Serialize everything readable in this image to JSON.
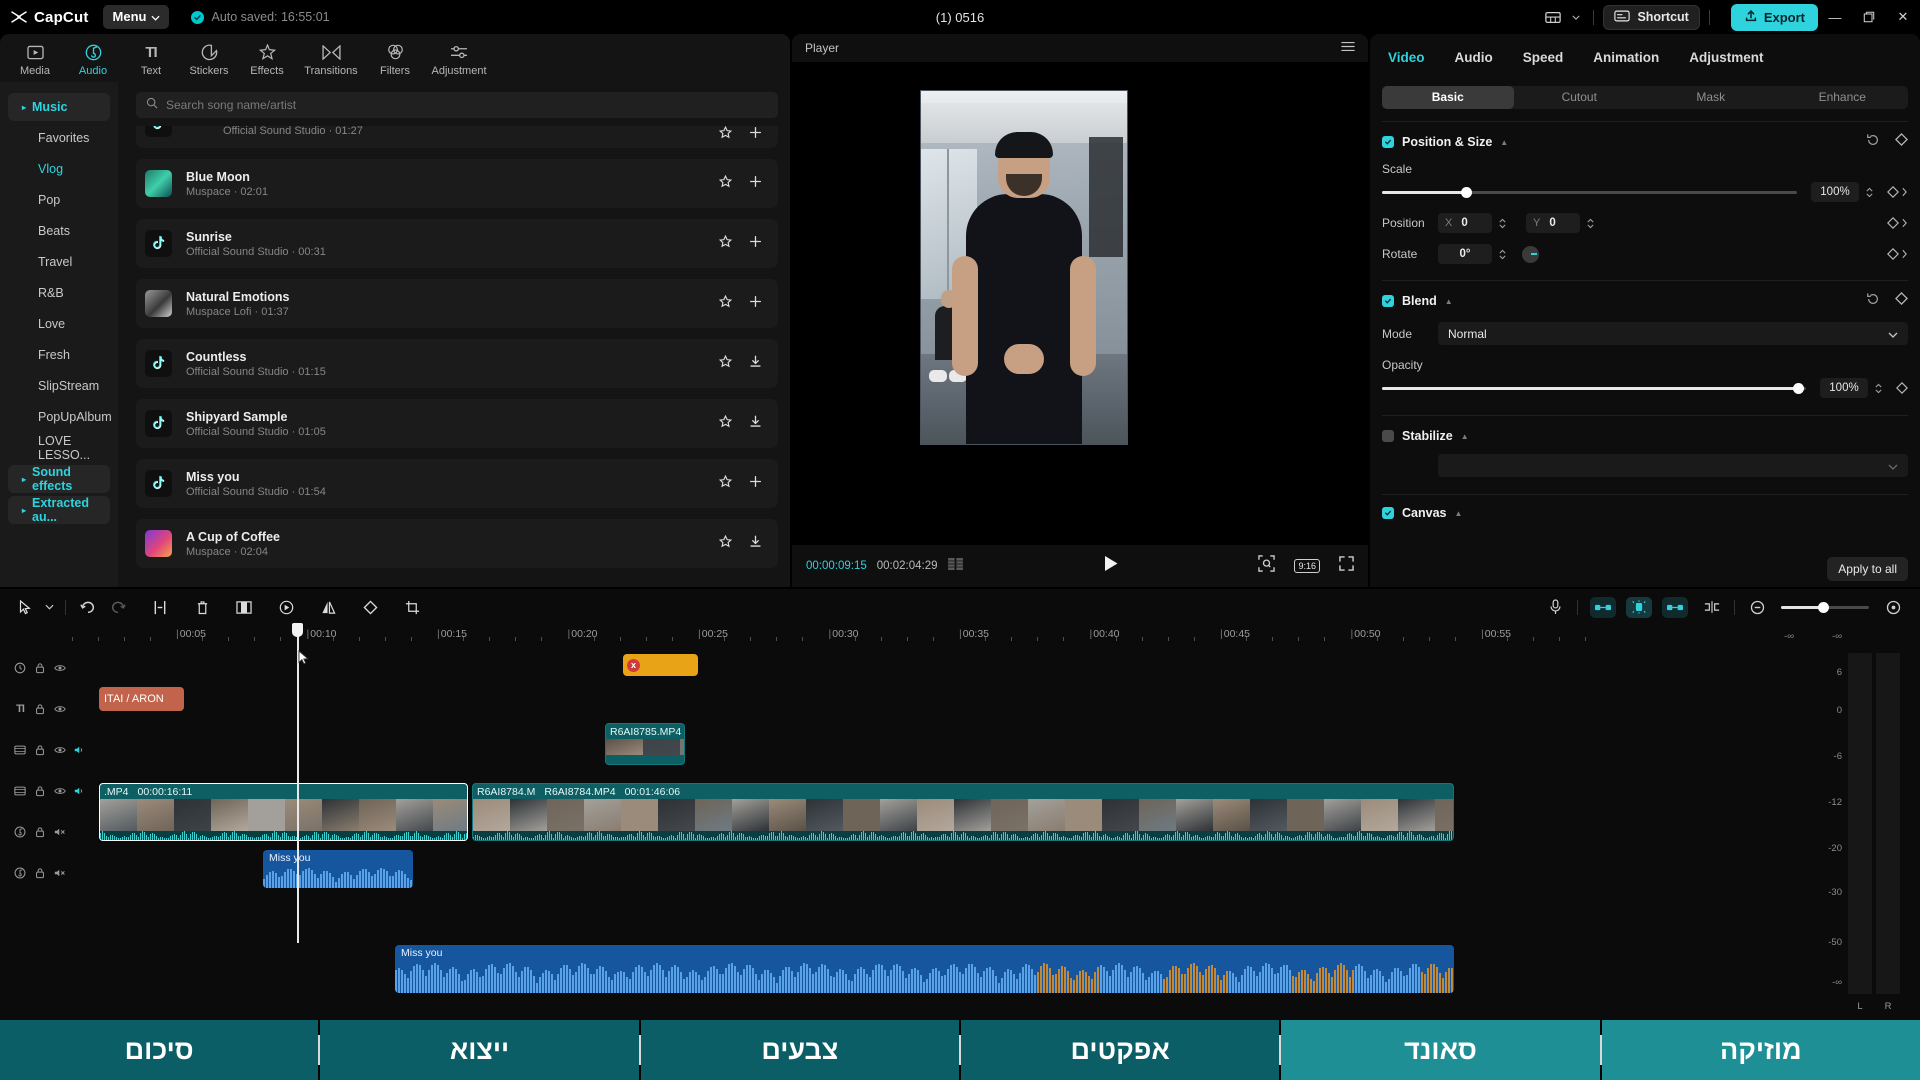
{
  "titlebar": {
    "app_name": "CapCut",
    "menu_label": "Menu",
    "autosave": "Auto saved: 16:55:01",
    "project_title": "(1) 0516",
    "shortcut_label": "Shortcut",
    "export_label": "Export",
    "minimize": "—",
    "maximize": "❐",
    "close": "✕"
  },
  "nav_tabs": [
    {
      "label": "Media",
      "icon": "media-icon",
      "active": false
    },
    {
      "label": "Audio",
      "icon": "audio-icon",
      "active": true
    },
    {
      "label": "Text",
      "icon": "text-icon",
      "active": false
    },
    {
      "label": "Stickers",
      "icon": "sticker-icon",
      "active": false
    },
    {
      "label": "Effects",
      "icon": "effects-icon",
      "active": false
    },
    {
      "label": "Transitions",
      "icon": "transitions-icon",
      "active": false
    },
    {
      "label": "Filters",
      "icon": "filters-icon",
      "active": false
    },
    {
      "label": "Adjustment",
      "icon": "adjustment-icon",
      "active": false
    }
  ],
  "categories": [
    {
      "label": "Music",
      "type": "group"
    },
    {
      "label": "Favorites",
      "type": "item"
    },
    {
      "label": "Vlog",
      "type": "selected"
    },
    {
      "label": "Pop",
      "type": "item"
    },
    {
      "label": "Beats",
      "type": "item"
    },
    {
      "label": "Travel",
      "type": "item"
    },
    {
      "label": "R&B",
      "type": "item"
    },
    {
      "label": "Love",
      "type": "item"
    },
    {
      "label": "Fresh",
      "type": "item"
    },
    {
      "label": "SlipStream",
      "type": "item"
    },
    {
      "label": "PopUpAlbum",
      "type": "item"
    },
    {
      "label": "LOVE LESSO...",
      "type": "item"
    },
    {
      "label": "Sound effects",
      "type": "group"
    },
    {
      "label": "Extracted au...",
      "type": "group"
    }
  ],
  "search": {
    "placeholder": "Search song name/artist",
    "value": ""
  },
  "songs": [
    {
      "title": "",
      "subtitle": "Official Sound Studio · 01:27",
      "cover": "tiktok",
      "action": "add",
      "clipped": true
    },
    {
      "title": "Blue Moon",
      "subtitle": "Muspace · 02:01",
      "cover": "art-teal",
      "action": "add"
    },
    {
      "title": "Sunrise",
      "subtitle": "Official Sound Studio · 00:31",
      "cover": "tiktok",
      "action": "add"
    },
    {
      "title": "Natural Emotions",
      "subtitle": "Muspace Lofi · 01:37",
      "cover": "art-gray",
      "action": "add"
    },
    {
      "title": "Countless",
      "subtitle": "Official Sound Studio · 01:15",
      "cover": "tiktok",
      "action": "download"
    },
    {
      "title": "Shipyard Sample",
      "subtitle": "Official Sound Studio · 01:05",
      "cover": "tiktok",
      "action": "download"
    },
    {
      "title": "Miss  you",
      "subtitle": "Official Sound Studio · 01:54",
      "cover": "tiktok",
      "action": "add"
    },
    {
      "title": "A Cup of Coffee",
      "subtitle": "Muspace · 02:04",
      "cover": "art-pink",
      "action": "download"
    }
  ],
  "player": {
    "label": "Player",
    "current_time": "00:00:09:15",
    "total_time": "00:02:04:29",
    "ratio": "9:16",
    "play_icon": "play-icon",
    "menu_icon": "hamburger-icon"
  },
  "props": {
    "tabs": [
      {
        "label": "Video",
        "active": true
      },
      {
        "label": "Audio",
        "active": false
      },
      {
        "label": "Speed",
        "active": false
      },
      {
        "label": "Animation",
        "active": false
      },
      {
        "label": "Adjustment",
        "active": false
      }
    ],
    "segments": [
      {
        "label": "Basic",
        "active": true
      },
      {
        "label": "Cutout",
        "active": false
      },
      {
        "label": "Mask",
        "active": false
      },
      {
        "label": "Enhance",
        "active": false
      }
    ],
    "position_size": {
      "title": "Position & Size",
      "checked": true,
      "scale_label": "Scale",
      "scale_value": "100%",
      "position_label": "Position",
      "pos_x_axis": "X",
      "pos_x_value": "0",
      "pos_y_axis": "Y",
      "pos_y_value": "0",
      "rotate_label": "Rotate",
      "rotate_value": "0°"
    },
    "blend": {
      "title": "Blend",
      "checked": true,
      "mode_label": "Mode",
      "mode_value": "Normal",
      "opacity_label": "Opacity",
      "opacity_value": "100%"
    },
    "stabilize": {
      "title": "Stabilize",
      "checked": false,
      "value": ""
    },
    "canvas": {
      "title": "Canvas",
      "checked": true
    },
    "apply_all_label": "Apply to all"
  },
  "timeline": {
    "tools": [
      "pointer-icon",
      "chevron-down-icon",
      "undo-icon",
      "redo-icon",
      "split-icon",
      "delete-icon",
      "crop-frame-icon",
      "freeze-icon",
      "mirror-icon",
      "rotate-icon",
      "crop-icon"
    ],
    "right_tools": [
      "microphone-icon",
      "link-icon",
      "auto-snap-icon",
      "unlink-icon",
      "cut-marker-icon",
      "zoom-out-icon",
      "zoom-in-icon"
    ],
    "ruler_labels": [
      "00:05",
      "00:10",
      "00:15",
      "00:20",
      "00:25",
      "00:30",
      "00:35",
      "00:40",
      "00:45",
      "00:50",
      "00:55"
    ],
    "playhead_time": "00:00:09:15",
    "tracks": [
      {
        "icons": [
          "clock-icon",
          "lock-icon",
          "eye-icon"
        ]
      },
      {
        "icons": [
          "text-icon",
          "lock-icon",
          "eye-icon"
        ]
      },
      {
        "icons": [
          "video-icon",
          "lock-icon",
          "eye-icon",
          "volume-icon"
        ]
      },
      {
        "icons": [
          "video-icon",
          "lock-icon",
          "eye-icon",
          "volume-icon"
        ]
      },
      {
        "icons": [
          "audio-icon",
          "lock-icon",
          "mute-icon"
        ]
      },
      {
        "icons": [
          "audio-icon",
          "lock-icon",
          "mute-icon"
        ]
      }
    ],
    "clips": {
      "effect": {
        "badge": "x"
      },
      "text": {
        "label": "ITAI / ARON"
      },
      "video_overlay": {
        "label": "R6AI8785.MP4"
      },
      "video_main_1": {
        "label": ".MP4",
        "duration": "00:00:16:11"
      },
      "video_main_2a": {
        "label": "R6AI8784.M"
      },
      "video_main_2b": {
        "label": "R6AI8784.MP4",
        "duration": "00:01:46:06"
      },
      "audio_1": {
        "label": "Miss  you"
      },
      "audio_2": {
        "label": "Miss  you"
      }
    },
    "meter": {
      "scale": [
        "6",
        "0",
        "-6",
        "-12",
        "-20",
        "-30",
        "-50",
        "-∞"
      ],
      "top_marks": [
        "-∞",
        "-∞"
      ],
      "channels": [
        "L",
        "R"
      ]
    }
  },
  "bottom_bar": {
    "items": [
      {
        "label": "סיכום",
        "accent": false
      },
      {
        "label": "ייצוא",
        "accent": false
      },
      {
        "label": "צבעים",
        "accent": false
      },
      {
        "label": "אפקטים",
        "accent": false
      },
      {
        "label": "סאונד",
        "accent": true
      },
      {
        "label": "מוזיקה",
        "accent": true
      }
    ]
  },
  "colors": {
    "accent": "#2ed3de",
    "export": "#2ed3de",
    "track_video": "#0d5f63",
    "track_audio": "#15569e",
    "track_text": "#c2644b",
    "track_effect": "#e8a317",
    "hebrew_bar": "#0b5d66"
  }
}
